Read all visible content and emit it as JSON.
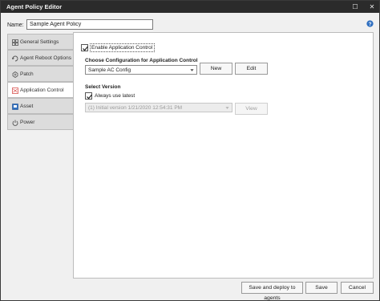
{
  "window": {
    "title": "Agent Policy Editor",
    "maximize_glyph": "☐",
    "close_glyph": "✕"
  },
  "name": {
    "label": "Name:",
    "value": "Sample Agent Policy"
  },
  "nav": {
    "items": [
      {
        "label": "General Settings",
        "icon": "general-settings-icon",
        "active": false
      },
      {
        "label": "Agent Reboot Options",
        "icon": "reboot-icon",
        "active": false
      },
      {
        "label": "Patch",
        "icon": "patch-icon",
        "active": false
      },
      {
        "label": "Application Control",
        "icon": "application-control-icon",
        "active": true
      },
      {
        "label": "Asset",
        "icon": "asset-icon",
        "active": false
      },
      {
        "label": "Power",
        "icon": "power-icon",
        "active": false
      }
    ]
  },
  "panel": {
    "enable_app_control": {
      "label": "Enable Application Control",
      "checked": true
    },
    "choose_config_heading": "Choose Configuration for Application Control",
    "config_select_value": "Sample AC Config",
    "new_button": "New",
    "edit_button": "Edit",
    "select_version_heading": "Select Version",
    "always_use_latest": {
      "label": "Always use latest",
      "checked": true
    },
    "version_select_value": "(1) Initial version 1/21/2020 12:54:31 PM",
    "view_button": "View"
  },
  "footer": {
    "save_deploy_button": "Save and deploy to agents",
    "save_button": "Save",
    "cancel_button": "Cancel"
  },
  "colors": {
    "titlebar": "#2b2b2b",
    "panel_bg": "#ffffff",
    "nav_bg": "#dcdcdc",
    "app_control_icon_accent": "#d9534f",
    "asset_icon_accent": "#2f6fc0"
  }
}
